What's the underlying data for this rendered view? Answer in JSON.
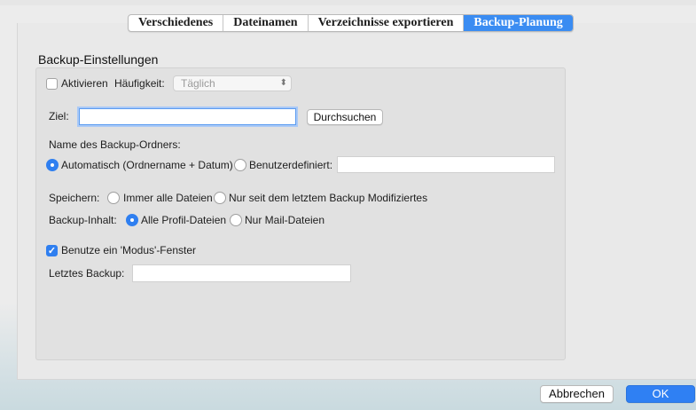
{
  "tabs": [
    {
      "label": "Verschiedenes",
      "active": false
    },
    {
      "label": "Dateinamen",
      "active": false
    },
    {
      "label": "Verzeichnisse exportieren",
      "active": false
    },
    {
      "label": "Backup-Planung",
      "active": true
    }
  ],
  "group": {
    "title": "Backup-Einstellungen",
    "activate_label": "Aktivieren",
    "activate_checked": false,
    "frequency_label": "Häufigkeit:",
    "frequency_value": "Täglich",
    "target_label": "Ziel:",
    "target_value": "",
    "browse_button": "Durchsuchen",
    "folder_name_label": "Name des Backup-Ordners:",
    "folder_auto_label": "Automatisch (Ordnername + Datum)",
    "folder_custom_label": "Benutzerdefiniert:",
    "folder_custom_value": "",
    "save_label": "Speichern:",
    "save_all_label": "Immer alle Dateien",
    "save_modified_label": "Nur seit dem letztem Backup Modifiziertes",
    "content_label": "Backup-Inhalt:",
    "content_all_label": "Alle Profil-Dateien",
    "content_mail_label": "Nur Mail-Dateien",
    "modal_label": "Benutze ein 'Modus'-Fenster",
    "modal_checked": true,
    "last_backup_label": "Letztes Backup:",
    "last_backup_value": ""
  },
  "footer": {
    "cancel_button": "Abbrechen",
    "ok_button": "OK"
  },
  "colors": {
    "accent": "#2f80f3",
    "panel": "#e1e1e1"
  }
}
